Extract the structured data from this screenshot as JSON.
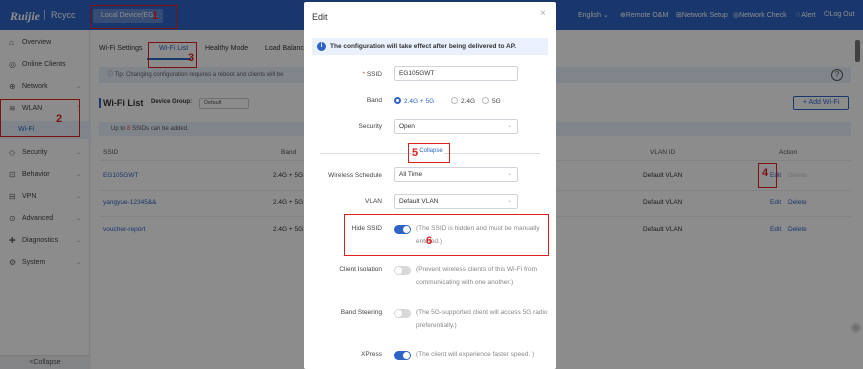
{
  "topbar": {
    "logo": "Ruijie",
    "brand": "Rcycc",
    "device_tab": "Local Device(EG1",
    "language": "English",
    "remote_om": "Remote O&M",
    "network_setup": "Network Setup",
    "network_check": "Network Check",
    "alert": "Alert",
    "logout": "Log Out"
  },
  "sidebar": {
    "items": [
      {
        "label": "Overview",
        "icon": "home-icon"
      },
      {
        "label": "Online Clients",
        "icon": "clients-icon"
      },
      {
        "label": "Network",
        "icon": "network-icon"
      },
      {
        "label": "WLAN",
        "icon": "wifi-icon"
      },
      {
        "label": "Security",
        "icon": "shield-icon"
      },
      {
        "label": "Behavior",
        "icon": "behavior-icon"
      },
      {
        "label": "VPN",
        "icon": "vpn-icon"
      },
      {
        "label": "Advanced",
        "icon": "advanced-icon"
      },
      {
        "label": "Diagnostics",
        "icon": "diagnostics-icon"
      },
      {
        "label": "System",
        "icon": "system-icon"
      }
    ],
    "wlan_sub": "Wi-Fi",
    "collapse": "Collapse"
  },
  "main": {
    "tabs": [
      "Wi-Fi Settings",
      "Wi-Fi List",
      "Healthy Mode",
      "Load Balanc"
    ],
    "tip": "Tip: Changing configuration requires a reboot and clients will be",
    "list_title": "Wi-Fi List",
    "device_group_label": "Device Group:",
    "device_group_value": "Default",
    "add_wifi": "+ Add Wi-Fi",
    "ssid_limit_prefix": "Up to",
    "ssid_limit_num": "8",
    "ssid_limit_suffix": "SSIDs can be added.",
    "columns": {
      "ssid": "SSID",
      "band": "Band",
      "vlan_id": "VLAN ID",
      "action": "Action"
    },
    "rows": [
      {
        "ssid": "EG105GWT",
        "band": "2.4G + 5G",
        "vlan": "Default VLAN",
        "edit": "Edit",
        "delete": "Delete"
      },
      {
        "ssid": "yangyue-12345&&",
        "band": "2.4G + 5G",
        "vlan": "Default VLAN",
        "edit": "Edit",
        "delete": "Delete"
      },
      {
        "ssid": "voucher-report",
        "band": "2.4G + 5G",
        "vlan": "Default VLAN",
        "edit": "Edit",
        "delete": "Delete"
      }
    ]
  },
  "modal": {
    "title": "Edit",
    "notice": "The configuration will take effect after being delivered to AP.",
    "ssid_label": "SSID",
    "ssid_value": "EG105GWT",
    "band_label": "Band",
    "band_options": [
      "2.4G + 5G",
      "2.4G",
      "5G"
    ],
    "band_selected": "2.4G + 5G",
    "security_label": "Security",
    "security_value": "Open",
    "collapse": "Collapse",
    "schedule_label": "Wireless Schedule",
    "schedule_value": "All Time",
    "vlan_label": "VLAN",
    "vlan_value": "Default VLAN",
    "hide_ssid_label": "Hide SSID",
    "hide_ssid_on": true,
    "hide_ssid_desc": "(The SSID is hidden and must be manually entered.)",
    "client_isolation_label": "Client Isolation",
    "client_isolation_on": false,
    "client_isolation_desc": "(Prevent wireless clients of this Wi-Fi from communicating with one another.)",
    "band_steering_label": "Band Steering",
    "band_steering_on": false,
    "band_steering_desc": "(The 5G-supported client will access 5G radio preferentially.)",
    "xpress_label": "XPress",
    "xpress_on": true,
    "xpress_desc": "(The client will experience faster speed. )"
  },
  "callouts": [
    "1",
    "2",
    "3",
    "4",
    "5",
    "6"
  ],
  "colors": {
    "brand": "#2f64c6",
    "callout": "#e02020"
  }
}
